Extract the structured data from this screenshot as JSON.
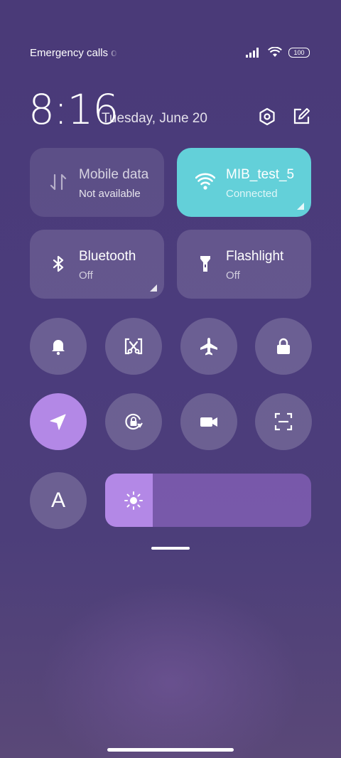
{
  "status_bar": {
    "carrier": "Emergency calls o",
    "battery": "100"
  },
  "header": {
    "time": "8:16",
    "date": "Tuesday, June 20"
  },
  "tiles": [
    {
      "title": "Mobile data",
      "subtitle": "Not available",
      "state": "disabled",
      "icon": "mobile-data-icon"
    },
    {
      "title": "MIB_test_5",
      "subtitle": "Connected",
      "state": "active",
      "icon": "wifi-icon"
    },
    {
      "title": "Bluetooth",
      "subtitle": "Off",
      "state": "off",
      "icon": "bluetooth-icon"
    },
    {
      "title": "Flashlight",
      "subtitle": "Off",
      "state": "off",
      "icon": "flashlight-icon"
    }
  ],
  "toggles": [
    {
      "name": "notification-bell-icon",
      "state": "off"
    },
    {
      "name": "screen-cast-icon",
      "state": "off"
    },
    {
      "name": "airplane-icon",
      "state": "off"
    },
    {
      "name": "lock-icon",
      "state": "off"
    },
    {
      "name": "location-icon",
      "state": "on"
    },
    {
      "name": "rotation-lock-icon",
      "state": "off"
    },
    {
      "name": "video-camera-icon",
      "state": "off"
    },
    {
      "name": "scan-icon",
      "state": "off"
    }
  ],
  "font_toggle": {
    "label": "A"
  },
  "brightness": {
    "level": 0.23
  },
  "colors": {
    "accent": "#b388e6",
    "wifi_active": "#63d0d9"
  }
}
